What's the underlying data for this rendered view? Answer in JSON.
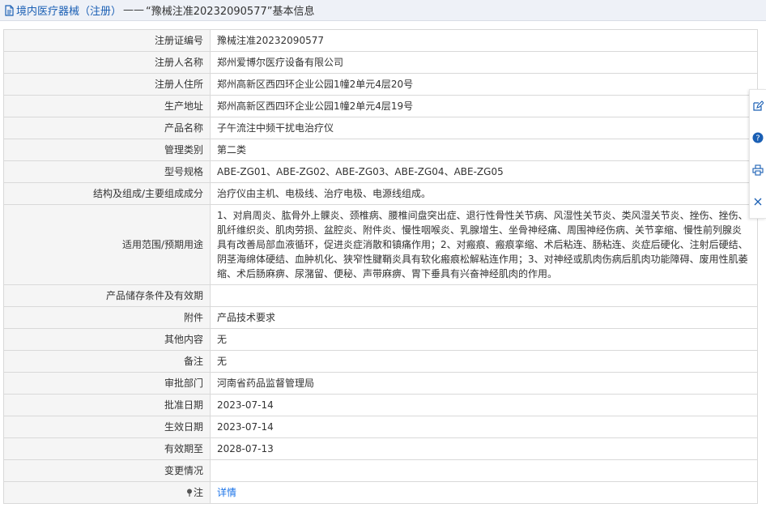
{
  "header": {
    "breadcrumb": "境内医疗器械（注册）",
    "separator": "——",
    "title": "“豫械注准20232090577”基本信息"
  },
  "rows": [
    {
      "label": "注册证编号",
      "value": "豫械注准20232090577"
    },
    {
      "label": "注册人名称",
      "value": "郑州爱博尔医疗设备有限公司"
    },
    {
      "label": "注册人住所",
      "value": "郑州高新区西四环企业公园1幢2单元4层20号"
    },
    {
      "label": "生产地址",
      "value": "郑州高新区西四环企业公园1幢2单元4层19号"
    },
    {
      "label": "产品名称",
      "value": "子午流注中频干扰电治疗仪"
    },
    {
      "label": "管理类别",
      "value": "第二类"
    },
    {
      "label": "型号规格",
      "value": "ABE-ZG01、ABE-ZG02、ABE-ZG03、ABE-ZG04、ABE-ZG05"
    },
    {
      "label": "结构及组成/主要组成成分",
      "value": "治疗仪由主机、电极线、治疗电极、电源线组成。"
    },
    {
      "label": "适用范围/预期用途",
      "value": "1、对肩周炎、肱骨外上髁炎、颈椎病、腰椎间盘突出症、退行性骨性关节病、风湿性关节炎、类风湿关节炎、挫伤、挫伤、肌纤维织炎、肌肉劳损、盆腔炎、附件炎、慢性咽喉炎、乳腺增生、坐骨神经痛、周围神经伤病、关节挛缩、慢性前列腺炎具有改善局部血液循环，促进炎症消散和镇痛作用；2、对瘢痕、瘢痕挛缩、术后粘连、肠粘连、炎症后硬化、注射后硬结、阴茎海绵体硬结、血肿机化、狭窄性腱鞘炎具有软化瘢痕松解粘连作用；3、对神经或肌肉伤病后肌肉功能障碍、废用性肌萎缩、术后肠麻痹、尿潴留、便秘、声带麻痹、胃下垂具有兴奋神经肌肉的作用。"
    },
    {
      "label": "产品储存条件及有效期",
      "value": ""
    },
    {
      "label": "附件",
      "value": "产品技术要求"
    },
    {
      "label": "其他内容",
      "value": "无"
    },
    {
      "label": "备注",
      "value": "无"
    },
    {
      "label": "审批部门",
      "value": "河南省药品监督管理局"
    },
    {
      "label": "批准日期",
      "value": "2023-07-14"
    },
    {
      "label": "生效日期",
      "value": "2023-07-14"
    },
    {
      "label": "有效期至",
      "value": "2028-07-13"
    },
    {
      "label": "变更情况",
      "value": ""
    }
  ],
  "note_row": {
    "label": "注",
    "link": "详情"
  },
  "side_tools": [
    "edit-icon",
    "help-icon",
    "print-icon",
    "close-icon"
  ],
  "colors": {
    "link": "#1a73e8",
    "label_bg": "#f5f5f5",
    "border": "#d9d9d9",
    "header_bg": "#eef1f7"
  }
}
